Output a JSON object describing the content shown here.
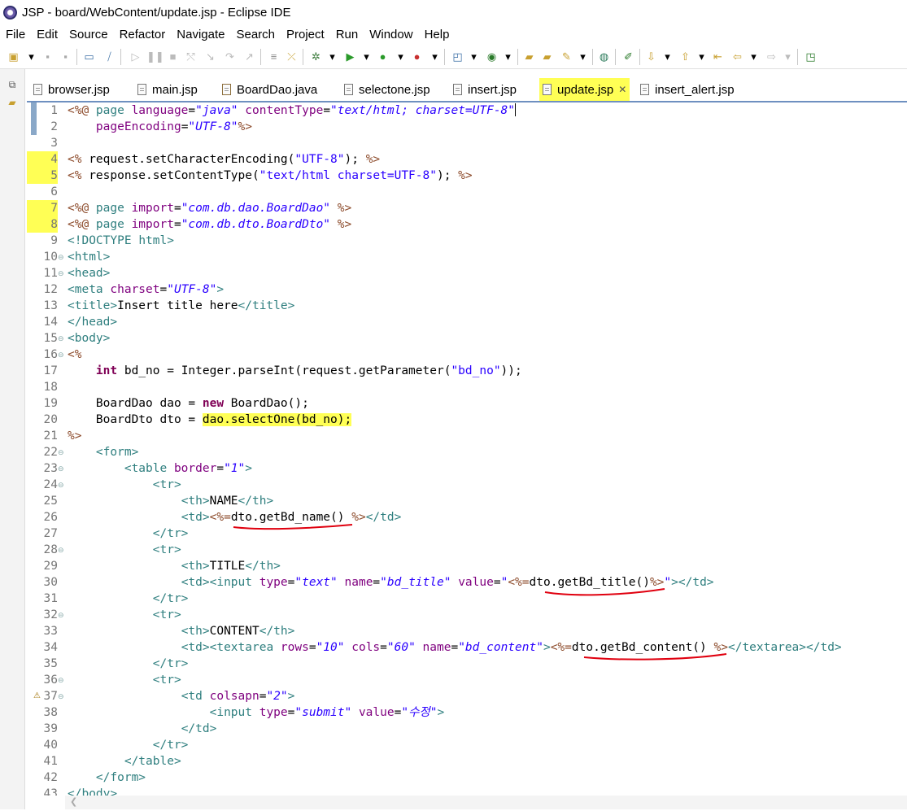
{
  "window": {
    "title": "JSP - board/WebContent/update.jsp - Eclipse IDE"
  },
  "menubar": [
    "File",
    "Edit",
    "Source",
    "Refactor",
    "Navigate",
    "Search",
    "Project",
    "Run",
    "Window",
    "Help"
  ],
  "tabs": [
    {
      "label": "browser.jsp",
      "type": "jsp",
      "active": false
    },
    {
      "label": "main.jsp",
      "type": "jsp",
      "active": false
    },
    {
      "label": "BoardDao.java",
      "type": "java",
      "active": false
    },
    {
      "label": "selectone.jsp",
      "type": "jsp",
      "active": false
    },
    {
      "label": "insert.jsp",
      "type": "jsp",
      "active": false
    },
    {
      "label": "update.jsp",
      "type": "jsp",
      "active": true
    },
    {
      "label": "insert_alert.jsp",
      "type": "jsp",
      "active": false
    }
  ],
  "colors": {
    "highlight": "#ffff55",
    "annotation": "#e0000f",
    "jsp_delimiter": "#8c4a2a",
    "html_tag": "#2f7f7f",
    "attribute": "#7f007f",
    "string": "#2a00ff",
    "keyword": "#7f0055"
  },
  "code": {
    "lines": [
      [
        [
          "<%@ ",
          "jsp"
        ],
        [
          "page ",
          "tag"
        ],
        [
          "language",
          "attr"
        ],
        [
          "=",
          "pl"
        ],
        [
          "\"java\"",
          "val"
        ],
        [
          " ",
          "pl"
        ],
        [
          "contentType",
          "attr"
        ],
        [
          "=",
          "pl"
        ],
        [
          "\"text/html; charset=UTF-8\"",
          "val"
        ]
      ],
      [
        [
          "    ",
          "pl"
        ],
        [
          "pageEncoding",
          "attr"
        ],
        [
          "=",
          "pl"
        ],
        [
          "\"UTF-8\"",
          "val"
        ],
        [
          "%>",
          "jsp"
        ]
      ],
      [],
      [
        [
          "<% ",
          "jsp"
        ],
        [
          "request.setCharacterEncoding(",
          "pl"
        ],
        [
          "\"UTF-8\"",
          "str"
        ],
        [
          "); ",
          "pl"
        ],
        [
          "%>",
          "jsp"
        ]
      ],
      [
        [
          "<% ",
          "jsp"
        ],
        [
          "response.setContentType(",
          "pl"
        ],
        [
          "\"text/html charset=UTF-8\"",
          "str"
        ],
        [
          "); ",
          "pl"
        ],
        [
          "%>",
          "jsp"
        ]
      ],
      [],
      [
        [
          "<%@ ",
          "jsp"
        ],
        [
          "page ",
          "tag"
        ],
        [
          "import",
          "attr"
        ],
        [
          "=",
          "pl"
        ],
        [
          "\"com.db.dao.BoardDao\"",
          "val"
        ],
        [
          " %>",
          "jsp"
        ]
      ],
      [
        [
          "<%@ ",
          "jsp"
        ],
        [
          "page ",
          "tag"
        ],
        [
          "import",
          "attr"
        ],
        [
          "=",
          "pl"
        ],
        [
          "\"com.db.dto.BoardDto\"",
          "val"
        ],
        [
          " %>",
          "jsp"
        ]
      ],
      [
        [
          "<!DOCTYPE ",
          "tag"
        ],
        [
          "html",
          "tag"
        ],
        [
          ">",
          "tag"
        ]
      ],
      [
        [
          "<html>",
          "tag"
        ]
      ],
      [
        [
          "<head>",
          "tag"
        ]
      ],
      [
        [
          "<meta ",
          "tag"
        ],
        [
          "charset",
          "attr"
        ],
        [
          "=",
          "pl"
        ],
        [
          "\"UTF-8\"",
          "val"
        ],
        [
          ">",
          "tag"
        ]
      ],
      [
        [
          "<title>",
          "tag"
        ],
        [
          "Insert title here",
          "pl"
        ],
        [
          "</title>",
          "tag"
        ]
      ],
      [
        [
          "</head>",
          "tag"
        ]
      ],
      [
        [
          "<body>",
          "tag"
        ]
      ],
      [
        [
          "<%",
          "jsp"
        ]
      ],
      [
        [
          "    ",
          "pl"
        ],
        [
          "int",
          "kw"
        ],
        [
          " bd_no = Integer.parseInt(request.getParameter(",
          "pl"
        ],
        [
          "\"bd_no\"",
          "str"
        ],
        [
          "));",
          "pl"
        ]
      ],
      [],
      [
        [
          "    BoardDao dao = ",
          "pl"
        ],
        [
          "new",
          "kw"
        ],
        [
          " BoardDao();",
          "pl"
        ]
      ],
      [
        [
          "    BoardDto dto = ",
          "pl"
        ],
        [
          "dao.selectOne(bd_no);",
          "hl"
        ]
      ],
      [
        [
          "%>",
          "jsp"
        ]
      ],
      [
        [
          "    ",
          "pl"
        ],
        [
          "<form>",
          "tag"
        ]
      ],
      [
        [
          "        ",
          "pl"
        ],
        [
          "<table ",
          "tag"
        ],
        [
          "border",
          "attr"
        ],
        [
          "=",
          "pl"
        ],
        [
          "\"1\"",
          "val"
        ],
        [
          ">",
          "tag"
        ]
      ],
      [
        [
          "            ",
          "pl"
        ],
        [
          "<tr>",
          "tag"
        ]
      ],
      [
        [
          "                ",
          "pl"
        ],
        [
          "<th>",
          "tag"
        ],
        [
          "NAME",
          "pl"
        ],
        [
          "</th>",
          "tag"
        ]
      ],
      [
        [
          "                ",
          "pl"
        ],
        [
          "<td>",
          "tag"
        ],
        [
          "<%=",
          "jsp"
        ],
        [
          "dto.getBd_name() ",
          "pl"
        ],
        [
          "%>",
          "jsp"
        ],
        [
          "</td>",
          "tag"
        ]
      ],
      [
        [
          "            ",
          "pl"
        ],
        [
          "</tr>",
          "tag"
        ]
      ],
      [
        [
          "            ",
          "pl"
        ],
        [
          "<tr>",
          "tag"
        ]
      ],
      [
        [
          "                ",
          "pl"
        ],
        [
          "<th>",
          "tag"
        ],
        [
          "TITLE",
          "pl"
        ],
        [
          "</th>",
          "tag"
        ]
      ],
      [
        [
          "                ",
          "pl"
        ],
        [
          "<td>",
          "tag"
        ],
        [
          "<input ",
          "tag"
        ],
        [
          "type",
          "attr"
        ],
        [
          "=",
          "pl"
        ],
        [
          "\"text\"",
          "val"
        ],
        [
          " ",
          "pl"
        ],
        [
          "name",
          "attr"
        ],
        [
          "=",
          "pl"
        ],
        [
          "\"bd_title\"",
          "val"
        ],
        [
          " ",
          "pl"
        ],
        [
          "value",
          "attr"
        ],
        [
          "=",
          "pl"
        ],
        [
          "\"",
          "str"
        ],
        [
          "<%=",
          "jsp"
        ],
        [
          "dto.getBd_title()",
          "pl"
        ],
        [
          "%>",
          "jsp"
        ],
        [
          "\"",
          "str"
        ],
        [
          ">",
          "tag"
        ],
        [
          "</td>",
          "tag"
        ]
      ],
      [
        [
          "            ",
          "pl"
        ],
        [
          "</tr>",
          "tag"
        ]
      ],
      [
        [
          "            ",
          "pl"
        ],
        [
          "<tr>",
          "tag"
        ]
      ],
      [
        [
          "                ",
          "pl"
        ],
        [
          "<th>",
          "tag"
        ],
        [
          "CONTENT",
          "pl"
        ],
        [
          "</th>",
          "tag"
        ]
      ],
      [
        [
          "                ",
          "pl"
        ],
        [
          "<td>",
          "tag"
        ],
        [
          "<textarea ",
          "tag"
        ],
        [
          "rows",
          "attr"
        ],
        [
          "=",
          "pl"
        ],
        [
          "\"10\"",
          "val"
        ],
        [
          " ",
          "pl"
        ],
        [
          "cols",
          "attr"
        ],
        [
          "=",
          "pl"
        ],
        [
          "\"60\"",
          "val"
        ],
        [
          " ",
          "pl"
        ],
        [
          "name",
          "attr"
        ],
        [
          "=",
          "pl"
        ],
        [
          "\"bd_content\"",
          "val"
        ],
        [
          ">",
          "tag"
        ],
        [
          "<%=",
          "jsp"
        ],
        [
          "dto.getBd_content() ",
          "pl"
        ],
        [
          "%>",
          "jsp"
        ],
        [
          "</textarea>",
          "tag"
        ],
        [
          "</td>",
          "tag"
        ]
      ],
      [
        [
          "            ",
          "pl"
        ],
        [
          "</tr>",
          "tag"
        ]
      ],
      [
        [
          "            ",
          "pl"
        ],
        [
          "<tr>",
          "tag"
        ]
      ],
      [
        [
          "                ",
          "pl"
        ],
        [
          "<td ",
          "tag"
        ],
        [
          "colsapn",
          "attr"
        ],
        [
          "=",
          "pl"
        ],
        [
          "\"2\"",
          "val"
        ],
        [
          ">",
          "tag"
        ]
      ],
      [
        [
          "                    ",
          "pl"
        ],
        [
          "<input ",
          "tag"
        ],
        [
          "type",
          "attr"
        ],
        [
          "=",
          "pl"
        ],
        [
          "\"submit\"",
          "val"
        ],
        [
          " ",
          "pl"
        ],
        [
          "value",
          "attr"
        ],
        [
          "=",
          "pl"
        ],
        [
          "\"수정\"",
          "val"
        ],
        [
          ">",
          "tag"
        ]
      ],
      [
        [
          "                ",
          "pl"
        ],
        [
          "</td>",
          "tag"
        ]
      ],
      [
        [
          "            ",
          "pl"
        ],
        [
          "</tr>",
          "tag"
        ]
      ],
      [
        [
          "        ",
          "pl"
        ],
        [
          "</table>",
          "tag"
        ]
      ],
      [
        [
          "    ",
          "pl"
        ],
        [
          "</form>",
          "tag"
        ]
      ],
      [
        [
          "</body>",
          "tag"
        ]
      ]
    ]
  }
}
